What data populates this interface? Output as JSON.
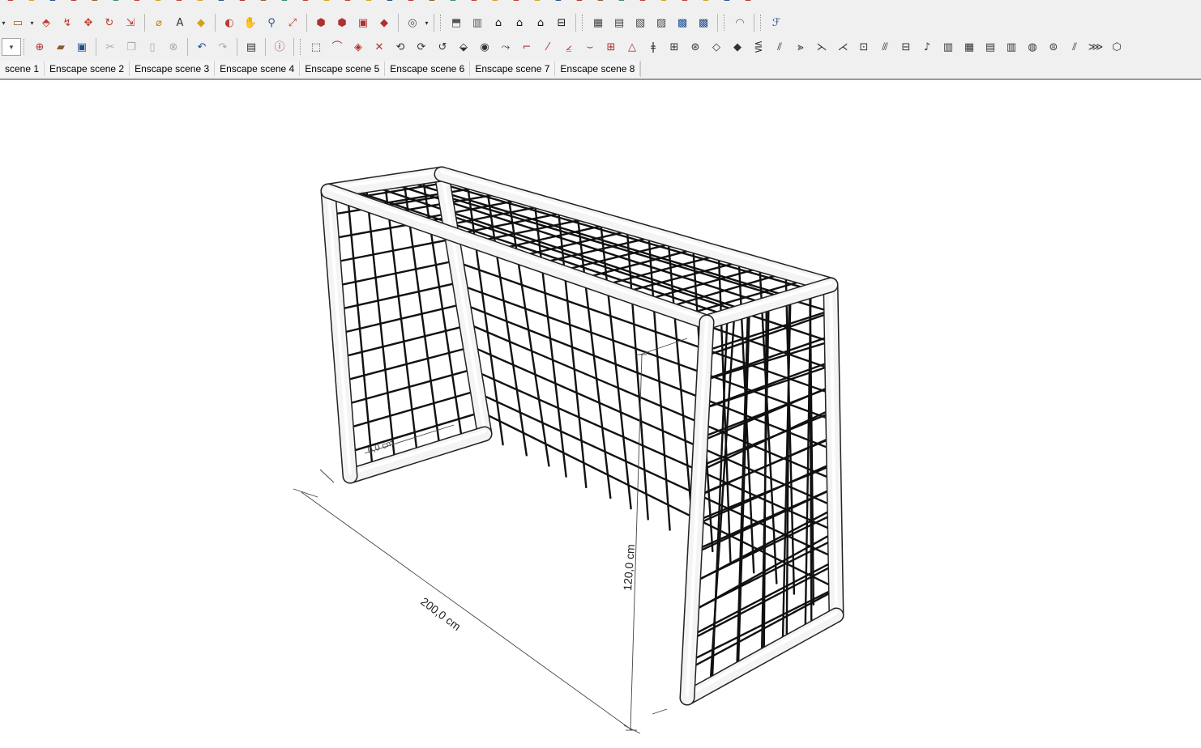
{
  "toolbar": {
    "row0": [
      "pencil",
      "arc",
      "paint",
      "eraser",
      "select",
      "move",
      "rotate",
      "push",
      "line",
      "rect",
      "circle",
      "tape",
      "text",
      "axes",
      "dims",
      "protractor",
      "tag",
      "paint-bucket",
      "sun",
      "section",
      "cube",
      "house",
      "shadow",
      "fog",
      "layers",
      "styles",
      "warehouse",
      "extension",
      "solid",
      "intersect",
      "union",
      "subtract",
      "trim",
      "split",
      "shell",
      "outer"
    ],
    "row1": [
      {
        "icon": "rectangle-icon",
        "glyph": "▭",
        "color": "#8b5a2b"
      },
      {
        "icon": "push-pull-icon",
        "glyph": "⬘",
        "color": "#c0392b"
      },
      {
        "icon": "follow-me-icon",
        "glyph": "↯",
        "color": "#c0392b"
      },
      {
        "icon": "move-icon",
        "glyph": "✥",
        "color": "#c0392b"
      },
      {
        "icon": "rotate-icon",
        "glyph": "↻",
        "color": "#c0392b"
      },
      {
        "icon": "scale-icon",
        "glyph": "⇲",
        "color": "#c0392b"
      },
      {
        "icon": "tape-measure-icon",
        "glyph": "⌀",
        "color": "#b8860b"
      },
      {
        "icon": "text-icon",
        "glyph": "A",
        "color": "#333"
      },
      {
        "icon": "paint-bucket-icon",
        "glyph": "◆",
        "color": "#d4a017"
      },
      {
        "icon": "orbit-icon",
        "glyph": "◐",
        "color": "#c0392b"
      },
      {
        "icon": "pan-icon",
        "glyph": "✋",
        "color": "#d4a017"
      },
      {
        "icon": "zoom-icon",
        "glyph": "⚲",
        "color": "#1f4e8c"
      },
      {
        "icon": "zoom-extents-icon",
        "glyph": "⤢",
        "color": "#c0392b"
      },
      {
        "icon": "warehouse-icon",
        "glyph": "⬢",
        "color": "#b03030"
      },
      {
        "icon": "share-model-icon",
        "glyph": "⬢",
        "color": "#b03030"
      },
      {
        "icon": "extension-icon",
        "glyph": "▣",
        "color": "#b03030"
      },
      {
        "icon": "ruby-icon",
        "glyph": "◆",
        "color": "#b03030"
      },
      {
        "icon": "user-icon",
        "glyph": "◎",
        "color": "#555"
      },
      {
        "icon": "iso-view-icon",
        "glyph": "⬒",
        "color": "#555"
      },
      {
        "icon": "top-view-icon",
        "glyph": "▥",
        "color": "#555"
      },
      {
        "icon": "front-view-icon",
        "glyph": "⌂",
        "color": "#111"
      },
      {
        "icon": "right-view-icon",
        "glyph": "⌂",
        "color": "#111"
      },
      {
        "icon": "back-view-icon",
        "glyph": "⌂",
        "color": "#111"
      },
      {
        "icon": "left-view-icon",
        "glyph": "⊟",
        "color": "#111"
      },
      {
        "icon": "xray-icon",
        "glyph": "▦",
        "color": "#444"
      },
      {
        "icon": "wireframe-icon",
        "glyph": "▤",
        "color": "#444"
      },
      {
        "icon": "hidden-line-icon",
        "glyph": "▧",
        "color": "#444"
      },
      {
        "icon": "shaded-icon",
        "glyph": "▨",
        "color": "#444"
      },
      {
        "icon": "textured-icon",
        "glyph": "▩",
        "color": "#1f4e8c"
      },
      {
        "icon": "monochrome-icon",
        "glyph": "▩",
        "color": "#1f4e8c"
      },
      {
        "icon": "sandbox-icon",
        "glyph": "◠",
        "color": "#666"
      },
      {
        "icon": "fredo-icon",
        "glyph": "ℱ",
        "color": "#1f4e8c"
      }
    ],
    "row2": [
      {
        "icon": "new-file-icon",
        "glyph": "⊕",
        "color": "#b03030"
      },
      {
        "icon": "open-folder-icon",
        "glyph": "▰",
        "color": "#8b5a2b"
      },
      {
        "icon": "save-icon",
        "glyph": "▣",
        "color": "#1f4e8c"
      },
      {
        "icon": "cut-icon",
        "glyph": "✂",
        "color": "#aaa"
      },
      {
        "icon": "copy-icon",
        "glyph": "❐",
        "color": "#aaa"
      },
      {
        "icon": "paste-icon",
        "glyph": "▯",
        "color": "#aaa"
      },
      {
        "icon": "erase-icon",
        "glyph": "⊗",
        "color": "#aaa"
      },
      {
        "icon": "undo-icon",
        "glyph": "↶",
        "color": "#1f4e8c"
      },
      {
        "icon": "redo-icon",
        "glyph": "↷",
        "color": "#aaa"
      },
      {
        "icon": "print-icon",
        "glyph": "▤",
        "color": "#333"
      },
      {
        "icon": "model-info-icon",
        "glyph": "ⓘ",
        "color": "#b03030"
      },
      {
        "icon": "tool-1-icon",
        "glyph": "⬚",
        "color": "#333"
      },
      {
        "icon": "tool-2-icon",
        "glyph": "⌒",
        "color": "#b03030"
      },
      {
        "icon": "tool-3-icon",
        "glyph": "◈",
        "color": "#b03030"
      },
      {
        "icon": "tool-4-icon",
        "glyph": "✕",
        "color": "#b03030"
      },
      {
        "icon": "tool-5-icon",
        "glyph": "⟲",
        "color": "#333"
      },
      {
        "icon": "tool-6-icon",
        "glyph": "⟳",
        "color": "#333"
      },
      {
        "icon": "tool-7-icon",
        "glyph": "↺",
        "color": "#333"
      },
      {
        "icon": "tool-8-icon",
        "glyph": "⬙",
        "color": "#333"
      },
      {
        "icon": "tool-9-icon",
        "glyph": "◉",
        "color": "#333"
      },
      {
        "icon": "tool-10-icon",
        "glyph": "⤳",
        "color": "#333"
      },
      {
        "icon": "tool-11-icon",
        "glyph": "⌐",
        "color": "#b03030"
      },
      {
        "icon": "tool-12-icon",
        "glyph": "⁄",
        "color": "#b03030"
      },
      {
        "icon": "tool-13-icon",
        "glyph": "⦤",
        "color": "#b03030"
      },
      {
        "icon": "tool-14-icon",
        "glyph": "⌣",
        "color": "#b03030"
      },
      {
        "icon": "tool-15-icon",
        "glyph": "⊞",
        "color": "#b03030"
      },
      {
        "icon": "tool-16-icon",
        "glyph": "△",
        "color": "#b03030"
      },
      {
        "icon": "tool-17-icon",
        "glyph": "ǂ",
        "color": "#333"
      },
      {
        "icon": "tool-18-icon",
        "glyph": "⊞",
        "color": "#333"
      },
      {
        "icon": "tool-19-icon",
        "glyph": "⊛",
        "color": "#333"
      },
      {
        "icon": "tool-20-icon",
        "glyph": "◇",
        "color": "#333"
      },
      {
        "icon": "tool-21-icon",
        "glyph": "◆",
        "color": "#333"
      },
      {
        "icon": "tool-22-icon",
        "glyph": "⋚",
        "color": "#333"
      },
      {
        "icon": "tool-23-icon",
        "glyph": "⫽",
        "color": "#333"
      },
      {
        "icon": "tool-24-icon",
        "glyph": "⪢",
        "color": "#333"
      },
      {
        "icon": "tool-25-icon",
        "glyph": "⋋",
        "color": "#333"
      },
      {
        "icon": "tool-26-icon",
        "glyph": "⋌",
        "color": "#333"
      },
      {
        "icon": "tool-27-icon",
        "glyph": "⊡",
        "color": "#333"
      },
      {
        "icon": "tool-28-icon",
        "glyph": "⫻",
        "color": "#333"
      },
      {
        "icon": "tool-29-icon",
        "glyph": "⊟",
        "color": "#333"
      },
      {
        "icon": "tool-30-icon",
        "glyph": "♪",
        "color": "#333"
      },
      {
        "icon": "tool-31-icon",
        "glyph": "▥",
        "color": "#333"
      },
      {
        "icon": "tool-32-icon",
        "glyph": "▦",
        "color": "#333"
      },
      {
        "icon": "tool-33-icon",
        "glyph": "▤",
        "color": "#333"
      },
      {
        "icon": "tool-34-icon",
        "glyph": "▥",
        "color": "#333"
      },
      {
        "icon": "tool-35-icon",
        "glyph": "◍",
        "color": "#333"
      },
      {
        "icon": "tool-36-icon",
        "glyph": "⊜",
        "color": "#333"
      },
      {
        "icon": "tool-37-icon",
        "glyph": "⫽",
        "color": "#333"
      },
      {
        "icon": "tool-38-icon",
        "glyph": "⋙",
        "color": "#333"
      },
      {
        "icon": "tool-39-icon",
        "glyph": "⬡",
        "color": "#333"
      }
    ]
  },
  "scenes": [
    "scene 1",
    "Enscape scene 2",
    "Enscape scene 3",
    "Enscape scene 4",
    "Enscape scene 5",
    "Enscape scene 6",
    "Enscape scene 7",
    "Enscape scene 8"
  ],
  "model": {
    "dimension_width": "200,0 cm",
    "dimension_height": "120,0 cm",
    "dimension_small": "0,0 cm"
  }
}
